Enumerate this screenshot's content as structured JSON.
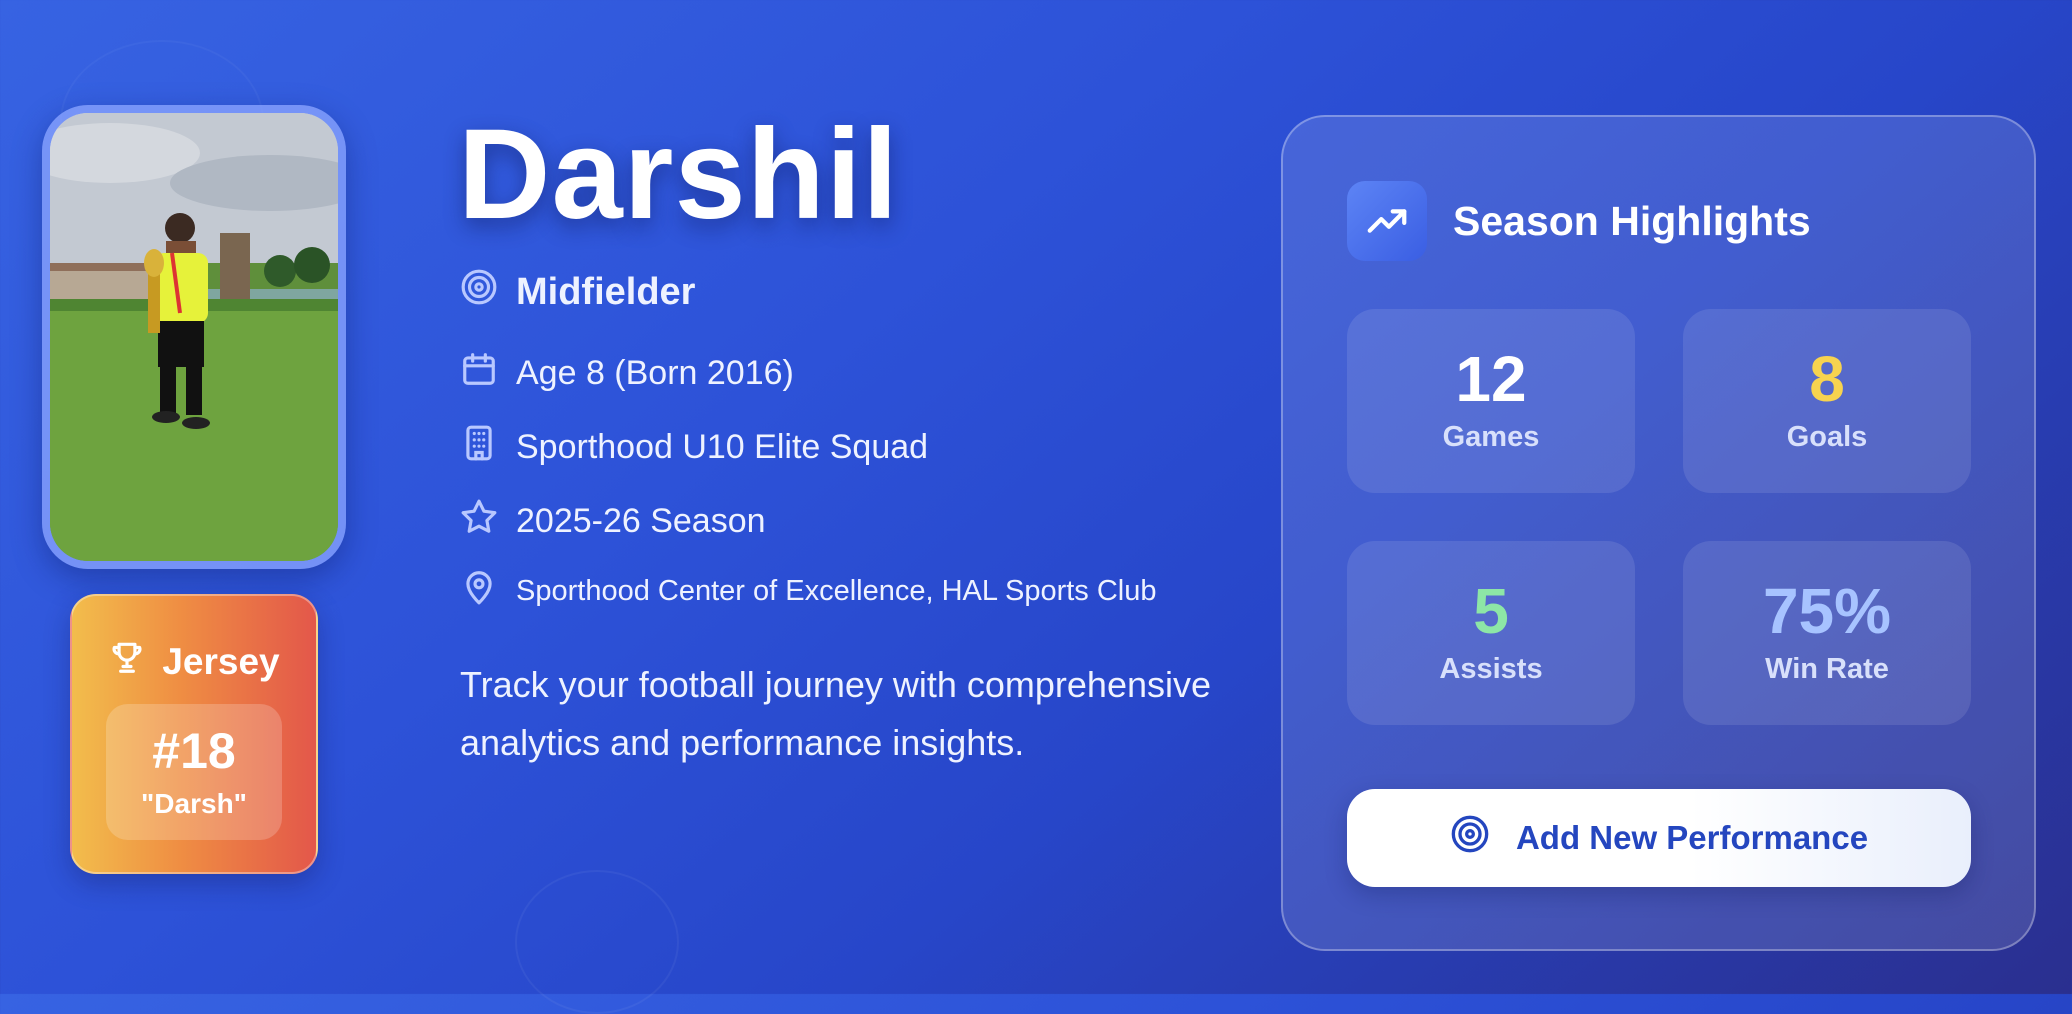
{
  "player": {
    "name": "Darshil",
    "position": "Midfielder",
    "age": "Age 8 (Born 2016)",
    "team": "Sporthood U10 Elite Squad",
    "season": "2025-26 Season",
    "venue": "Sporthood Center of Excellence, HAL Sports Club",
    "tagline": "Track your football journey with comprehensive analytics and performance insights."
  },
  "jersey": {
    "label": "Jersey",
    "number": "#18",
    "nickname": "\"Darsh\""
  },
  "highlights": {
    "title": "Season Highlights",
    "stats": [
      {
        "value": "12",
        "label": "Games",
        "color": "#ffffff"
      },
      {
        "value": "8",
        "label": "Goals",
        "color": "#f7d34f"
      },
      {
        "value": "5",
        "label": "Assists",
        "color": "#8de6a6"
      },
      {
        "value": "75%",
        "label": "Win Rate",
        "color": "#a7c3ff"
      }
    ],
    "button_label": "Add New Performance"
  },
  "icons": {
    "position": "target-icon",
    "age": "calendar-icon",
    "team": "building-icon",
    "season": "star-icon",
    "venue": "map-pin-icon",
    "jersey": "trophy-icon",
    "highlights": "trending-up-icon",
    "button": "target-icon"
  }
}
